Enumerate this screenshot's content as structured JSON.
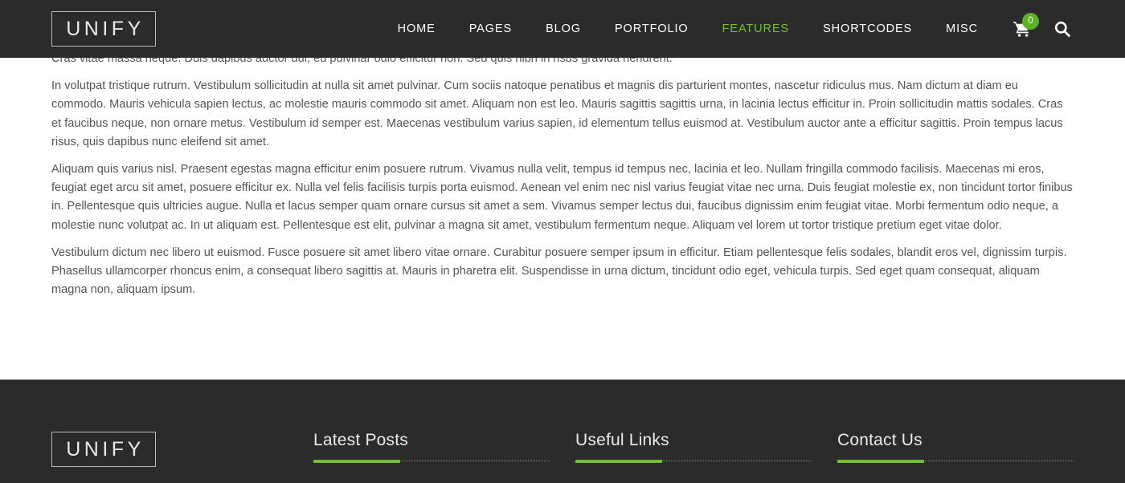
{
  "header": {
    "logo": "UNIFY",
    "nav": [
      {
        "label": "HOME",
        "active": false
      },
      {
        "label": "PAGES",
        "active": false
      },
      {
        "label": "BLOG",
        "active": false
      },
      {
        "label": "PORTFOLIO",
        "active": false
      },
      {
        "label": "FEATURES",
        "active": true
      },
      {
        "label": "SHORTCODES",
        "active": false
      },
      {
        "label": "MISC",
        "active": false
      }
    ],
    "cart": {
      "icon": "shopping-cart-icon",
      "badge_count": "0"
    },
    "search": {
      "icon": "search-icon"
    },
    "background_color": "#2b2b2b",
    "accent_color": "#72c02c"
  },
  "main": {
    "paragraphs": [
      "Cras vitae massa neque. Duis dapibus auctor dui, eu pulvinar odio efficitur non. Sed quis nibh in risus gravida hendrerit.",
      "In volutpat tristique rutrum. Vestibulum sollicitudin at nulla sit amet pulvinar. Cum sociis natoque penatibus et magnis dis parturient montes, nascetur ridiculus mus. Nam dictum at diam eu commodo. Mauris vehicula sapien lectus, ac molestie mauris commodo sit amet. Aliquam non est leo. Mauris sagittis sagittis urna, in lacinia lectus efficitur in. Proin sollicitudin mattis sodales. Cras et faucibus neque, non ornare metus. Vestibulum id semper est. Maecenas vestibulum varius sapien, id elementum tellus euismod at. Vestibulum auctor ante a efficitur sagittis. Proin tempus lacus risus, quis dapibus nunc eleifend sit amet.",
      "Aliquam quis varius nisl. Praesent egestas magna efficitur enim posuere rutrum. Vivamus nulla velit, tempus id tempus nec, lacinia et leo. Nullam fringilla commodo facilisis. Maecenas mi eros, feugiat eget arcu sit amet, posuere efficitur ex. Nulla vel felis facilisis turpis porta euismod. Aenean vel enim nec nisl varius feugiat vitae nec urna. Duis feugiat molestie ex, non tincidunt tortor finibus in. Pellentesque quis ultricies augue. Nulla et lacus semper quam ornare cursus sit amet a sem. Vivamus semper lectus dui, faucibus dignissim enim feugiat vitae. Morbi fermentum odio neque, a molestie nunc volutpat ac. In ut aliquam est. Pellentesque est elit, pulvinar a magna sit amet, vestibulum fermentum neque. Aliquam vel lorem ut tortor tristique pretium eget vitae dolor.",
      "Vestibulum dictum nec libero ut euismod. Fusce posuere sit amet libero vitae ornare. Curabitur posuere semper ipsum in efficitur. Etiam pellentesque felis sodales, blandit eros vel, dignissim turpis. Phasellus ullamcorper rhoncus enim, a consequat libero sagittis at. Mauris in pharetra elit. Suspendisse in urna dictum, tincidunt odio eget, vehicula turpis. Sed eget quam consequat, aliquam magna non, aliquam ipsum."
    ],
    "text_color": "#555555"
  },
  "footer": {
    "logo": "UNIFY",
    "columns": [
      {
        "heading": "Latest Posts"
      },
      {
        "heading": "Useful Links"
      },
      {
        "heading": "Contact Us"
      }
    ],
    "background_color": "#2b2b2b",
    "accent_color": "#72c02c"
  }
}
